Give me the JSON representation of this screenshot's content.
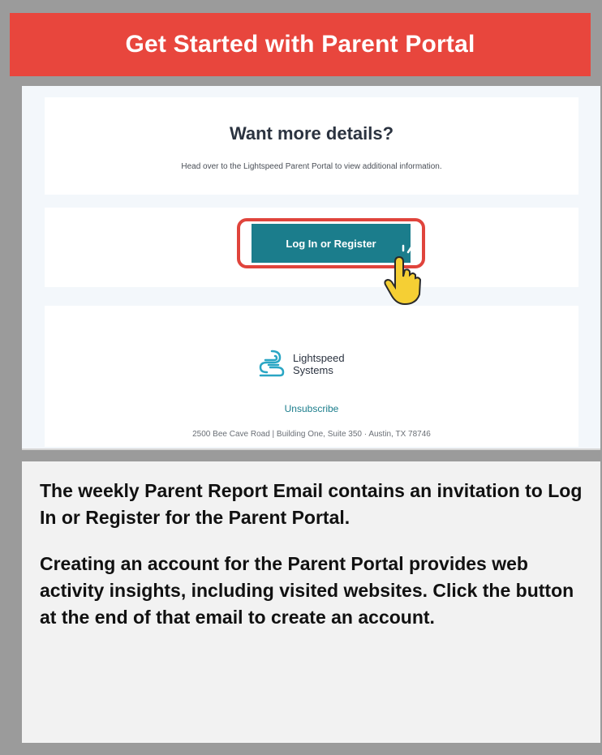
{
  "banner": {
    "title": "Get Started with Parent Portal"
  },
  "email": {
    "heading": "Want more details?",
    "subtext": "Head over to the Lightspeed Parent Portal to view additional information.",
    "cta_label": "Log In or Register",
    "brand_line1": "Lightspeed",
    "brand_line2": "Systems",
    "unsubscribe": "Unsubscribe",
    "address": "2500 Bee Cave Road | Building One, Suite 350 · Austin, TX 78746"
  },
  "info": {
    "para1_a": "The weekly Parent Report Email contains an invitation to ",
    "para1_bold": "Log In or Register",
    "para1_b": " for the Parent Portal.",
    "para2_a": "Creating an account for the ",
    "para2_bold": "Parent Portal",
    "para2_b": " provides web activity insights, including visited websites. Click the button at the end of that email to create an account."
  },
  "colors": {
    "banner": "#e8463d",
    "button": "#1b7d8c",
    "highlight": "#e0443c"
  },
  "icons": {
    "cursor": "hand-pointer-icon",
    "logo": "lightspeed-logo-icon"
  }
}
